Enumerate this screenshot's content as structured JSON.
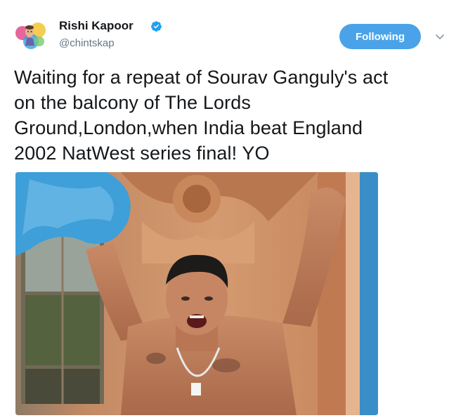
{
  "author": {
    "name": "Rishi Kapoor",
    "handle": "@chintskap",
    "verified": true,
    "avatar_icon": "avatar-watercolor-portrait"
  },
  "follow_button": {
    "label": "Following",
    "color": "#4aa3e8"
  },
  "more_icon": "chevron-down-icon",
  "tweet": {
    "lines": [
      "Waiting for a repeat of Sourav Ganguly's act",
      "on the balcony of The Lords",
      "Ground,London,when India beat England",
      "2002 NatWest series final! YO"
    ]
  },
  "media": {
    "kind": "photo"
  },
  "colors": {
    "text": "#14171a",
    "secondary": "#657786",
    "accent": "#1da1f2"
  }
}
